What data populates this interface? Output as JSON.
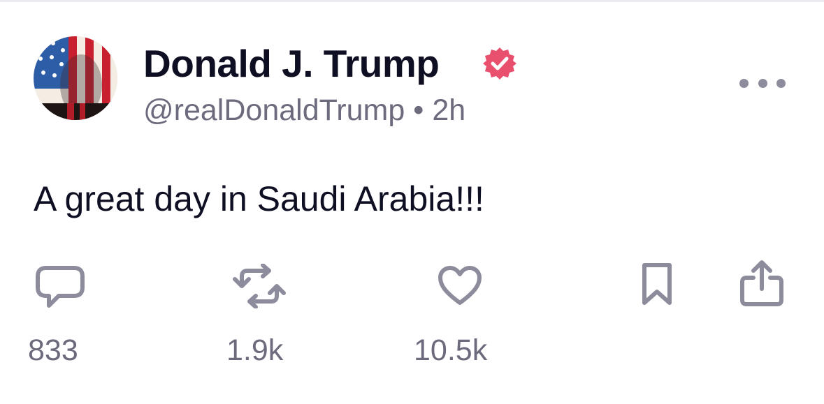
{
  "post": {
    "author": {
      "display_name": "Donald J. Trump",
      "handle": "@realDonaldTrump",
      "verified": true,
      "avatar_icon": "flag-face-avatar"
    },
    "separator": "•",
    "time_ago": "2h",
    "text": "A great day in Saudi Arabia!!!",
    "actions": {
      "reply": {
        "icon": "reply-icon",
        "count": "833"
      },
      "repost": {
        "icon": "repost-icon",
        "count": "1.9k"
      },
      "like": {
        "icon": "heart-icon",
        "count": "10.5k"
      },
      "bookmark": {
        "icon": "bookmark-icon"
      },
      "share": {
        "icon": "share-icon"
      }
    },
    "more_icon": "more-icon"
  },
  "colors": {
    "text_primary": "#0f0f24",
    "text_secondary": "#6c6b7d",
    "icon_gray": "#8d8c9c",
    "verified_badge": "#e9506e",
    "divider": "#ececf0"
  }
}
